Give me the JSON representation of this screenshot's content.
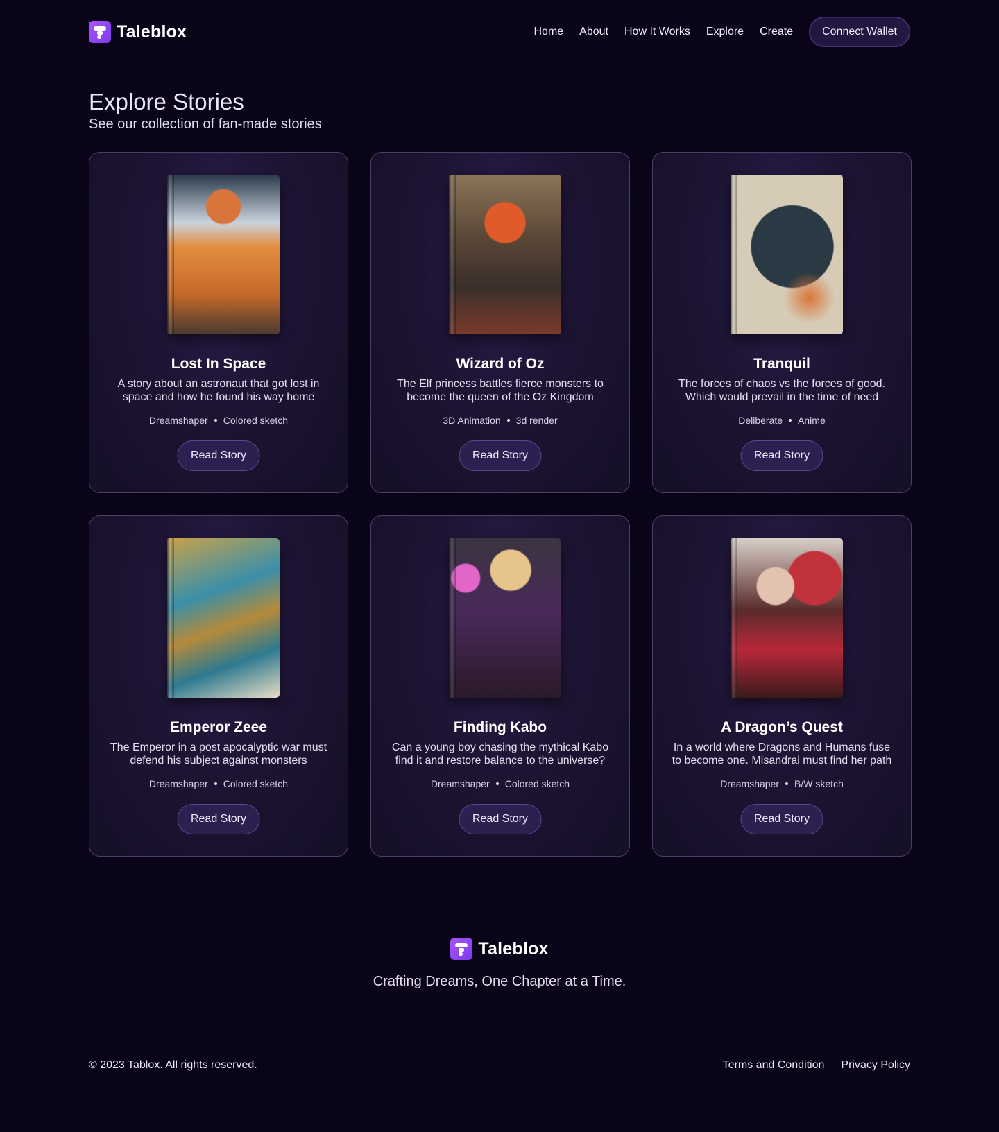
{
  "brand": {
    "name": "Taleblox",
    "accent": "#8b5cf6"
  },
  "nav": {
    "links": [
      "Home",
      "About",
      "How It Works",
      "Explore",
      "Create"
    ],
    "wallet_label": "Connect Wallet"
  },
  "header": {
    "title": "Explore Stories",
    "subtitle": "See our collection of fan-made stories"
  },
  "stories": [
    {
      "title": "Lost In Space",
      "description": "A story about an astronaut that got lost in space and how he found his way home",
      "tags": [
        "Dreamshaper",
        "Colored sketch"
      ],
      "button": "Read Story"
    },
    {
      "title": "Wizard of Oz",
      "description": "The Elf princess battles fierce monsters to become the queen of the Oz Kingdom",
      "tags": [
        "3D Animation",
        "3d render"
      ],
      "button": "Read Story"
    },
    {
      "title": "Tranquil",
      "description": "The forces of chaos vs the forces of good. Which would prevail in the time of need",
      "tags": [
        "Deliberate",
        "Anime"
      ],
      "button": "Read Story"
    },
    {
      "title": "Emperor Zeee",
      "description": "The Emperor in a post apocalyptic war must defend his subject against monsters",
      "tags": [
        "Dreamshaper",
        "Colored sketch"
      ],
      "button": "Read Story"
    },
    {
      "title": "Finding Kabo",
      "description": "Can a young boy chasing the mythical Kabo find it and restore balance to the universe?",
      "tags": [
        "Dreamshaper",
        "Colored sketch"
      ],
      "button": "Read Story"
    },
    {
      "title": "A Dragon’s Quest",
      "description": "In a world where Dragons and Humans fuse to become one. Misandrai must find her path",
      "tags": [
        "Dreamshaper",
        "B/W sketch"
      ],
      "button": "Read Story"
    }
  ],
  "footer": {
    "brand": "Taleblox",
    "tagline": "Crafting Dreams, One Chapter at a Time.",
    "copyright": "© 2023 Tablox. All rights reserved.",
    "links": [
      "Terms and Condition",
      "Privacy Policy"
    ]
  }
}
